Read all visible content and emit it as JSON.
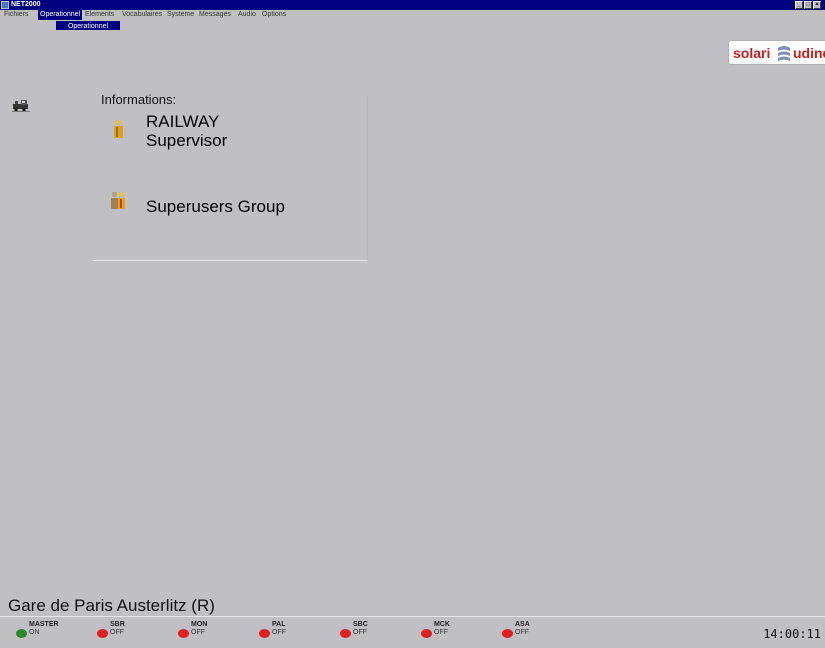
{
  "window": {
    "title": "NET2000",
    "buttons": [
      "_",
      "□",
      "×"
    ]
  },
  "menubar": {
    "items": [
      {
        "label": "Fichiers"
      },
      {
        "label": "Operationnel"
      },
      {
        "label": "Elements"
      },
      {
        "label": "Vocabulaires"
      },
      {
        "label": "Systeme"
      },
      {
        "label": "Messages"
      },
      {
        "label": "Audio"
      },
      {
        "label": "Options"
      }
    ],
    "active_index": 1,
    "dropdown": {
      "items": [
        {
          "label": "Operationnel"
        }
      ]
    }
  },
  "logo": {
    "left_text": "solari",
    "right_text": "udine",
    "brand_color": "#d11a1a"
  },
  "info": {
    "title": "Informations:",
    "user": {
      "line1": "RAILWAY",
      "line2": "Supervisor",
      "icon": "user-icon"
    },
    "group": {
      "name": "Superusers Group",
      "icon": "group-icon"
    }
  },
  "station": {
    "name": "Gare de Paris Austerlitz (R)"
  },
  "status": {
    "items": [
      {
        "name": "MASTER",
        "state": "ON",
        "color": "#2a8a2a"
      },
      {
        "name": "SBR",
        "state": "OFF",
        "color": "#e02020"
      },
      {
        "name": "MON",
        "state": "OFF",
        "color": "#e02020"
      },
      {
        "name": "PAL",
        "state": "OFF",
        "color": "#e02020"
      },
      {
        "name": "SBC",
        "state": "OFF",
        "color": "#e02020"
      },
      {
        "name": "MCK",
        "state": "OFF",
        "color": "#e02020"
      },
      {
        "name": "ASA",
        "state": "OFF",
        "color": "#e02020"
      }
    ],
    "time": "14:00:11"
  }
}
